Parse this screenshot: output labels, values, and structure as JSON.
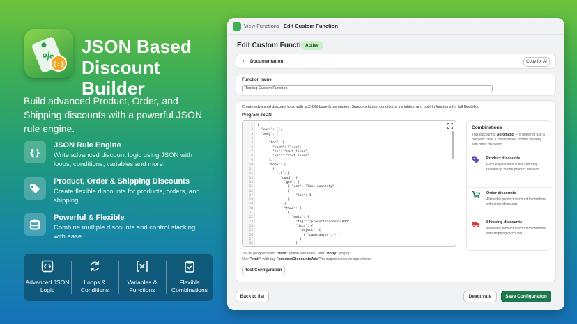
{
  "hero": {
    "title": "JSON Based Discount Builder",
    "subtitle": "Build advanced Product, Order, and Shipping discounts with a powerful JSON rule engine."
  },
  "features": [
    {
      "icon": "braces-icon",
      "title": "JSON Rule Engine",
      "desc": "Write advanced discount logic using JSON with loops, conditions, variables and more."
    },
    {
      "icon": "tags-icon",
      "title": "Product, Order & Shipping Discounts",
      "desc": "Create flexible discounts for products, orders, and shipping."
    },
    {
      "icon": "database-icon",
      "title": "Powerful & Flexible",
      "desc": "Combine multiple discounts and control stacking with ease."
    }
  ],
  "bottom_bar": [
    {
      "icon": "code-icon",
      "label": "Advanced JSON Logic"
    },
    {
      "icon": "loop-icon",
      "label": "Loops & Conditions"
    },
    {
      "icon": "variable-icon",
      "label": "Variables & Functions"
    },
    {
      "icon": "clipboard-check-icon",
      "label": "Flexible Combinations"
    }
  ],
  "app": {
    "breadcrumb_parent": "View Functions",
    "breadcrumb_sep": "/",
    "breadcrumb_current": "Edit Custom Function",
    "page_title": "Edit Custom Function",
    "status_badge": "Active",
    "documentation_label": "Documentation",
    "copy_button": "Copy for AI",
    "function_name_label": "Function name",
    "function_name_value": "Testing Custom Function",
    "intro_text": "Create advanced discount logic with a JSON-based rule engine. Supports loops, conditions, variables, and built-in functions for full flexibility.",
    "program_label": "Program JSON",
    "code_lines": [
      "{",
      "  \"vars\": [],",
      "  \"body\": [",
      "    {",
      "      \"for\": {",
      "        \"each\": \"line\",",
      "        \"in\": \"cart.lines\",",
      "        \"var\": \"cart.lines\"",
      "      },",
      "      \"body\": [",
      "        {",
      "          \"if\": {",
      "            \"cond\": {",
      "              \"gte\": [",
      "                { \"var\": \"line.quantity\" },",
      "                {",
      "                  { \"lit\": 3 }",
      "                }",
      "              },",
      "              \"then\": [",
      "                {",
      "                  \"emit\": {",
      "                    \"tag\": \"productDiscountsAdd\",",
      "                    \"data\": {",
      "                      \"object\": {",
      "                        { \"candidates\": -- }",
      "                      }",
      "                    }"
    ],
    "helper_line1_pre": "JSON program with ",
    "helper_line1_b1": "\"vars\"",
    "helper_line1_mid": " (initial variables) and ",
    "helper_line1_b2": "\"body\"",
    "helper_line1_post": " (logic).",
    "helper_line2_pre": "Use ",
    "helper_line2_b1": "\"emit\"",
    "helper_line2_mid": " with tag ",
    "helper_line2_b2": "\"productDiscountsAdd\"",
    "helper_line2_post": " to output discount operations.",
    "test_button": "Test Configuration",
    "combinations": {
      "title": "Combinations",
      "desc_pre": "This discount is ",
      "desc_bold": "Automatic",
      "desc_post": " — it does not use a discount code. Combinations control stacking with other discounts.",
      "items": [
        {
          "icon": "tag-icon",
          "title": "Product discounts",
          "desc": "Each eligible item in the cart may receive up to one product discount"
        },
        {
          "icon": "cart-icon",
          "title": "Order discounts",
          "desc": "Allow this product discount to combine with order discounts"
        },
        {
          "icon": "truck-icon",
          "title": "Shipping discounts",
          "desc": "Allow this product discount to combine with shipping discounts"
        }
      ]
    },
    "back_button": "Back to list",
    "deactivate_button": "Deactivate",
    "save_button": "Save Configuration"
  },
  "colors": {
    "primary": "#1a7a4c",
    "badge_bg": "#cdf1c6",
    "product_icon": "#6b46c1",
    "order_icon": "#1a7a4c",
    "shipping_icon": "#d43f3a"
  }
}
